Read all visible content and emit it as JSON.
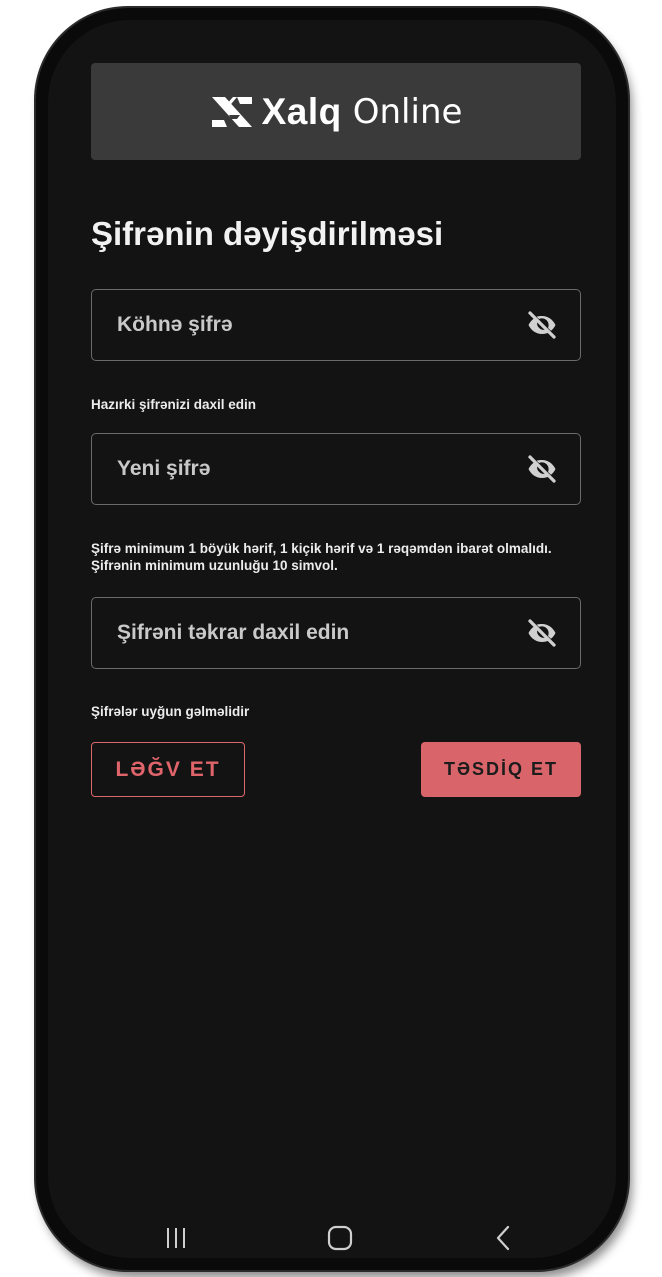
{
  "app": {
    "logo_bold": "Xalq",
    "logo_light": "Online",
    "logo_icon": "xalq-logo-icon"
  },
  "page": {
    "title": "Şifrənin dəyişdirilməsi"
  },
  "fields": [
    {
      "placeholder": "Köhnə şifrə",
      "value": "",
      "icon": "eye-off-icon",
      "helper": "Hazırki şifrənizi daxil edin"
    },
    {
      "placeholder": "Yeni şifrə",
      "value": "",
      "icon": "eye-off-icon",
      "helper": "Şifrə minimum 1 böyük hərif, 1 kiçik hərif və 1 rəqəmdən ibarət olmalıdı. Şifrənin minimum uzunluğu 10 simvol."
    },
    {
      "placeholder": "Şifrəni təkrar daxil edin",
      "value": "",
      "icon": "eye-off-icon",
      "helper": "Şifrələr uyğun gəlməlidir"
    }
  ],
  "actions": {
    "cancel_label": "LƏĞV ET",
    "confirm_label": "TƏSDİQ ET"
  },
  "system_nav": {
    "items": [
      "recent-apps-icon",
      "home-icon",
      "back-icon"
    ]
  },
  "colors": {
    "background": "#131313",
    "logo_bar": "#3a3a3a",
    "accent": "#d9656b",
    "field_border": "#6a6a6a",
    "text": "#f2f2f2"
  }
}
